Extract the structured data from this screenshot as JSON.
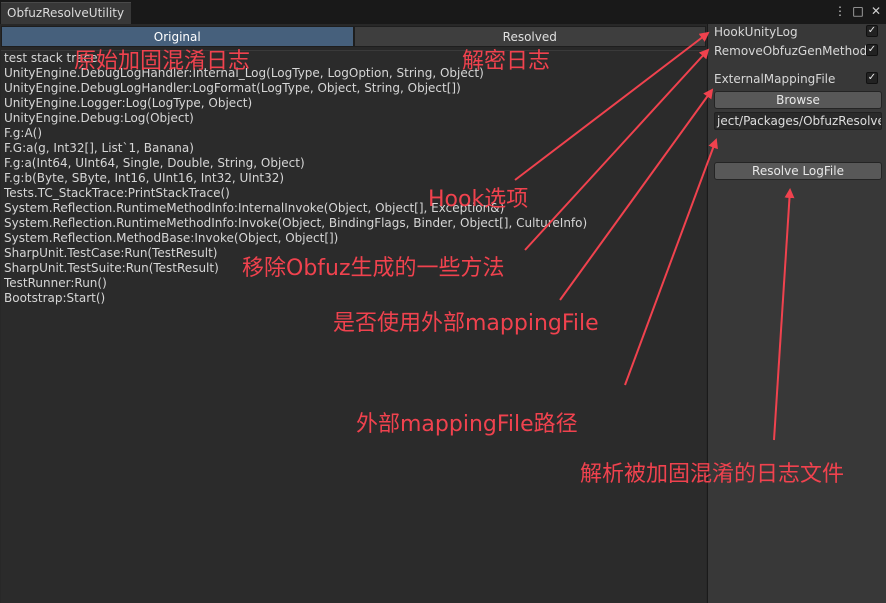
{
  "window": {
    "tab_title": "ObfuzResolveUtility",
    "controls": {
      "menu_icon": "⋮",
      "maximize_icon": "□",
      "close_icon": "✕"
    }
  },
  "toolbar": {
    "original_label": "Original",
    "resolved_label": "Resolved"
  },
  "log_lines": [
    "test stack trace:",
    "UnityEngine.DebugLogHandler:Internal_Log(LogType, LogOption, String, Object)",
    "UnityEngine.DebugLogHandler:LogFormat(LogType, Object, String, Object[])",
    "UnityEngine.Logger:Log(LogType, Object)",
    "UnityEngine.Debug:Log(Object)",
    "F.g:A()",
    "F.G:a(g, Int32[], List`1, Banana)",
    "F.g:a(Int64, UInt64, Single, Double, String, Object)",
    "F.g:b(Byte, SByte, Int16, UInt16, Int32, UInt32)",
    "Tests.TC_StackTrace:PrintStackTrace()",
    "System.Reflection.RuntimeMethodInfo:InternalInvoke(Object, Object[], Exception&)",
    "System.Reflection.RuntimeMethodInfo:Invoke(Object, BindingFlags, Binder, Object[], CultureInfo)",
    "System.Reflection.MethodBase:Invoke(Object, Object[])",
    "SharpUnit.TestCase:Run(TestResult)",
    "SharpUnit.TestSuite:Run(TestResult)",
    "TestRunner:Run()",
    "Bootstrap:Start()"
  ],
  "options": {
    "hook_label": "HookUnityLog",
    "hook_checked": true,
    "remove_label": "RemoveObfuzGenMethod",
    "remove_checked": true,
    "external_label": "ExternalMappingFile",
    "external_checked": true,
    "browse_label": "Browse",
    "mapping_path": "ject/Packages/ObfuzResolve",
    "resolve_label": "Resolve LogFile",
    "check_glyph": "✓"
  },
  "annotations": {
    "original_log": "原始加固混淆日志",
    "decrypted_log": "解密日志",
    "hook_option": "Hook选项",
    "remove_methods": "移除Obfuz生成的一些方法",
    "use_external": "是否使用外部mappingFile",
    "external_path": "外部mappingFile路径",
    "resolve_file": "解析被加固混淆的日志文件"
  },
  "colors": {
    "annotation": "#f0424e",
    "tab_active": "#46607c",
    "panel": "#383838"
  }
}
